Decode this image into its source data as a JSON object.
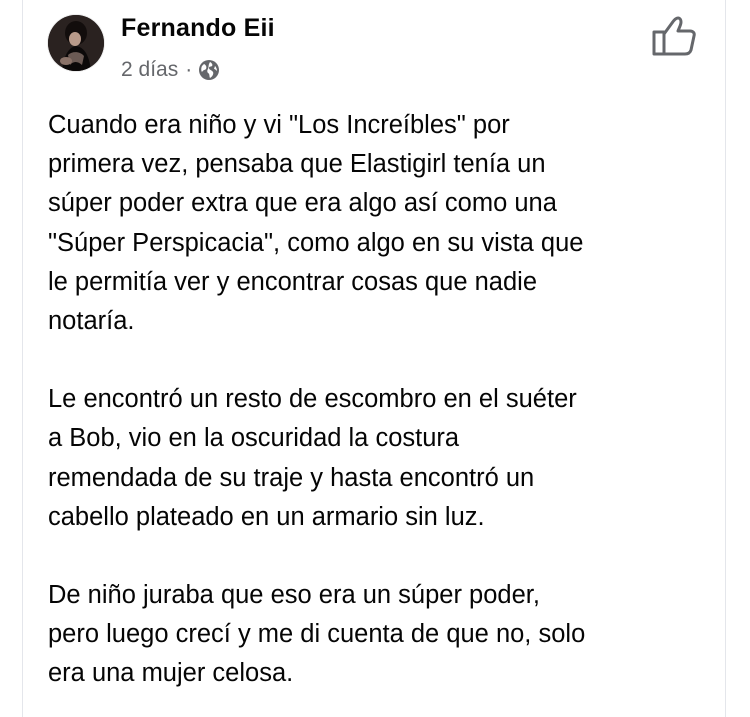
{
  "post": {
    "author_name": "Fernando Eii",
    "timestamp": "2 días",
    "separator": "·",
    "audience_icon": "globe-icon",
    "reaction_icon": "thumbs-up-icon",
    "paragraphs": [
      {
        "lines": [
          "Cuando era niño y vi \"Los Increíbles\" por",
          "primera vez, pensaba que Elastigirl tenía un",
          "súper poder extra que era algo así como una",
          "\"Súper Perspicacia\", como algo en su vista que",
          "le permitía ver y encontrar cosas que nadie",
          "notaría."
        ]
      },
      {
        "lines": [
          "Le encontró un resto de escombro en el suéter",
          "a Bob, vio en la oscuridad la costura",
          "remendada de su traje y hasta encontró un",
          "cabello plateado en un armario sin luz."
        ]
      },
      {
        "lines": [
          "De niño juraba que eso era un súper poder,",
          "pero luego crecí y me di cuenta de que no, solo",
          "era una mujer celosa."
        ]
      }
    ]
  },
  "colors": {
    "text_primary": "#050505",
    "text_secondary": "#65676b",
    "divider": "#e4e6eb"
  }
}
